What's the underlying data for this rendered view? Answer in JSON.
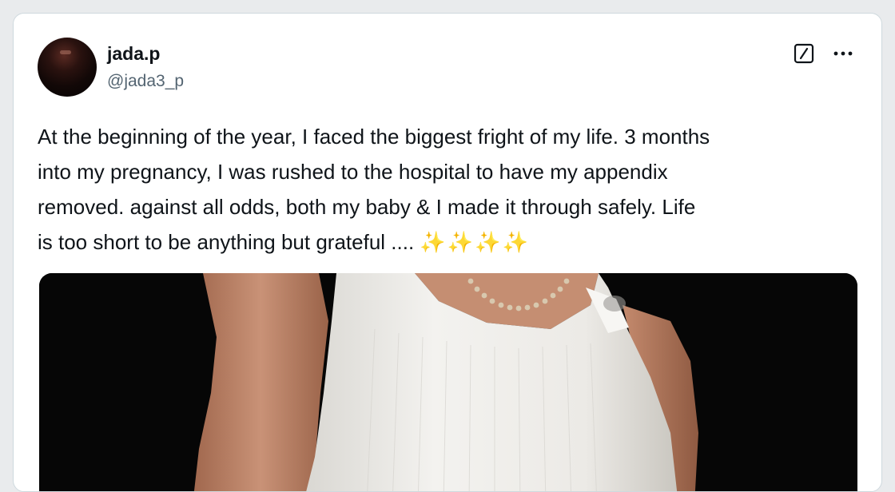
{
  "tweet": {
    "author_name": "jada.p",
    "author_handle": "@jada3_p",
    "text_lines": [
      "At the beginning of the year, I faced the biggest fright of my life. 3 months",
      "into my pregnancy, I was rushed to the hospital to have my appendix",
      "removed. against all odds, both my baby & I made it through safely. Life",
      "is too short to be anything but grateful ...."
    ],
    "sparkles": "✨✨✨✨"
  },
  "icons": {
    "grok": "grok-icon",
    "more": "more-options-icon",
    "sparkle": "sparkles-emoji"
  },
  "colors": {
    "name": "#0f1419",
    "handle": "#536471",
    "border": "#cfd9de",
    "sparkle": "#f5b400",
    "media_background": "#060606"
  }
}
